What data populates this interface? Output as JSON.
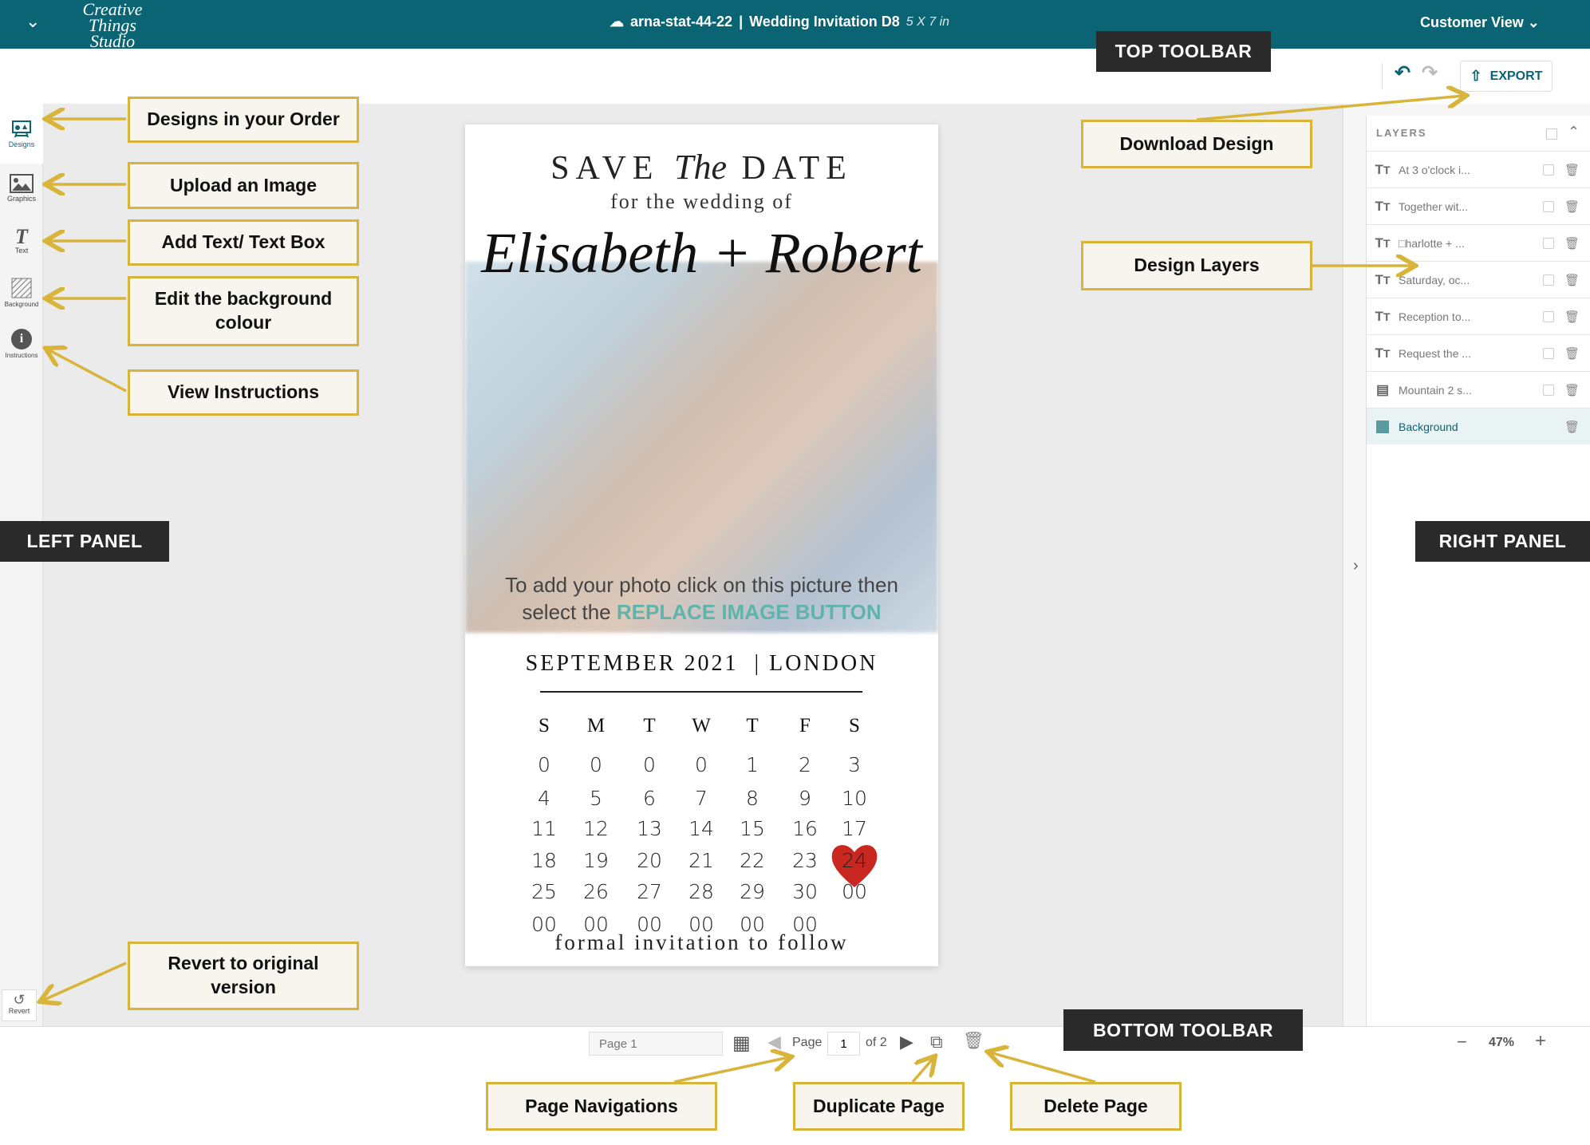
{
  "header": {
    "logo_text": "Creative Things Studio",
    "doc_id": "arna-stat-44-22",
    "separator": "|",
    "doc_name": "Wedding Invitation D8",
    "doc_size": "5 X 7 in",
    "view_label": "Customer View"
  },
  "toolbar": {
    "export_label": "EXPORT"
  },
  "left_panel": {
    "items": [
      {
        "label": "Designs"
      },
      {
        "label": "Graphics"
      },
      {
        "label": "Text"
      },
      {
        "label": "Background"
      },
      {
        "label": "Instructions"
      }
    ],
    "revert_label": "Revert"
  },
  "layers": {
    "title": "LAYERS",
    "items": [
      {
        "type": "text",
        "label": "At 3 o'clock i..."
      },
      {
        "type": "text",
        "label": "Together wit..."
      },
      {
        "type": "text",
        "label": "□harlotte + ..."
      },
      {
        "type": "text",
        "label": "Saturday, oc..."
      },
      {
        "type": "text",
        "label": "Reception to..."
      },
      {
        "type": "text",
        "label": "Request the ..."
      },
      {
        "type": "image",
        "label": "Mountain 2 s..."
      },
      {
        "type": "background",
        "label": "Background",
        "selected": true
      }
    ]
  },
  "card": {
    "save": "SAVE",
    "the": "The",
    "date": "DATE",
    "subtitle": "for the wedding of",
    "names": "Elisabeth + Robert",
    "photo_hint_1": "To add your photo click on this picture then",
    "photo_hint_2_prefix": "select the",
    "photo_hint_2_highlight": "REPLACE IMAGE BUTTON",
    "month": "SEPTEMBER 2021",
    "city": "LONDON",
    "weekdays": [
      "S",
      "M",
      "T",
      "W",
      "T",
      "F",
      "S"
    ],
    "weeks": [
      [
        "0",
        "0",
        "0",
        "0",
        "1",
        "2",
        "3"
      ],
      [
        "4",
        "5",
        "6",
        "7",
        "8",
        "9",
        "10"
      ],
      [
        "11",
        "12",
        "13",
        "14",
        "15",
        "16",
        "17"
      ],
      [
        "18",
        "19",
        "20",
        "21",
        "22",
        "23",
        "24"
      ],
      [
        "25",
        "26",
        "27",
        "28",
        "29",
        "30",
        "00"
      ],
      [
        "00",
        "00",
        "00",
        "00",
        "00",
        "00",
        ""
      ]
    ],
    "highlight_day": "24",
    "footer": "formal invitation to follow"
  },
  "bottom": {
    "page_name_placeholder": "Page 1",
    "page_label": "Page",
    "page_value": "1",
    "of_label": "of 2",
    "zoom": "47%",
    "zoom_minus": "−",
    "zoom_plus": "+"
  },
  "annotations": {
    "designs": "Designs in your Order",
    "upload": "Upload an Image",
    "text": "Add Text/ Text Box",
    "background": "Edit the background colour",
    "instructions": "View Instructions",
    "revert": "Revert to original version",
    "left_panel": "LEFT PANEL",
    "top_toolbar": "TOP TOOLBAR",
    "download": "Download Design",
    "layers": "Design Layers",
    "right_panel": "RIGHT PANEL",
    "bottom_toolbar": "BOTTOM TOOLBAR",
    "page_nav": "Page Navigations",
    "duplicate": "Duplicate Page",
    "delete": "Delete Page"
  },
  "colors": {
    "brand": "#0b6474",
    "annotation_border": "#d8b43a",
    "heart": "#c8281f",
    "highlight_text": "#5fb3aa"
  }
}
